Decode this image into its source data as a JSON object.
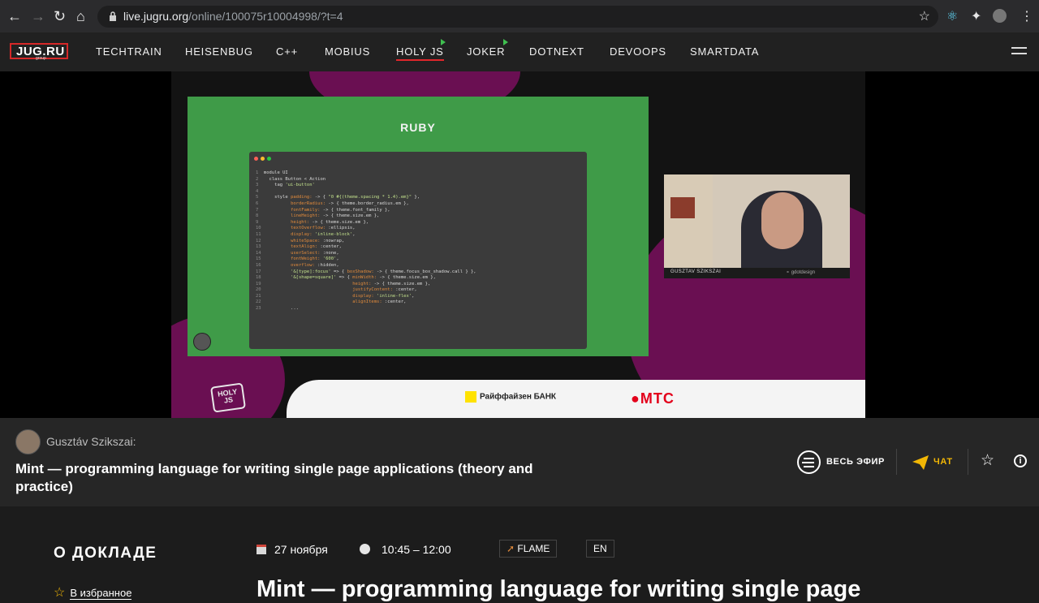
{
  "browser": {
    "url_host": "live.jugru.org",
    "url_path": "/online/100075r10004998/?t=4"
  },
  "site": {
    "logo": "JUG.RU",
    "logo_sub": "group",
    "menu": [
      "TECHTRAIN",
      "HEISENBUG",
      "C++",
      "MOBIUS",
      "HOLY JS",
      "JOKER",
      "DOTNEXT",
      "DEVOOPS",
      "SMARTDATA"
    ]
  },
  "video": {
    "slide_title": "RUBY",
    "cam_name": "GUSZTAV SZIKSZAI",
    "cam_handle": "gdotdesign",
    "sponsor1": "Райффайзен БАНК",
    "sponsor2": "МТС",
    "holy_badge": "HOLY JS"
  },
  "info": {
    "speaker": "Gusztáv Szikszai:",
    "title": "Mint — programming language for writing single page applications (theory and practice)",
    "all_stream": "ВЕСЬ ЭФИР",
    "chat": "ЧАТ"
  },
  "about": {
    "heading": "О ДОКЛАДЕ",
    "favorite": "В избранное",
    "date": "27 ноября",
    "time": "10:45 – 12:00",
    "tag": "FLAME",
    "lang": "EN",
    "big_title": "Mint — programming language for writing single page"
  },
  "colors": {
    "accent_red": "#e0262b",
    "live_green": "#3fbf4f",
    "chat_yellow": "#f2b705"
  }
}
